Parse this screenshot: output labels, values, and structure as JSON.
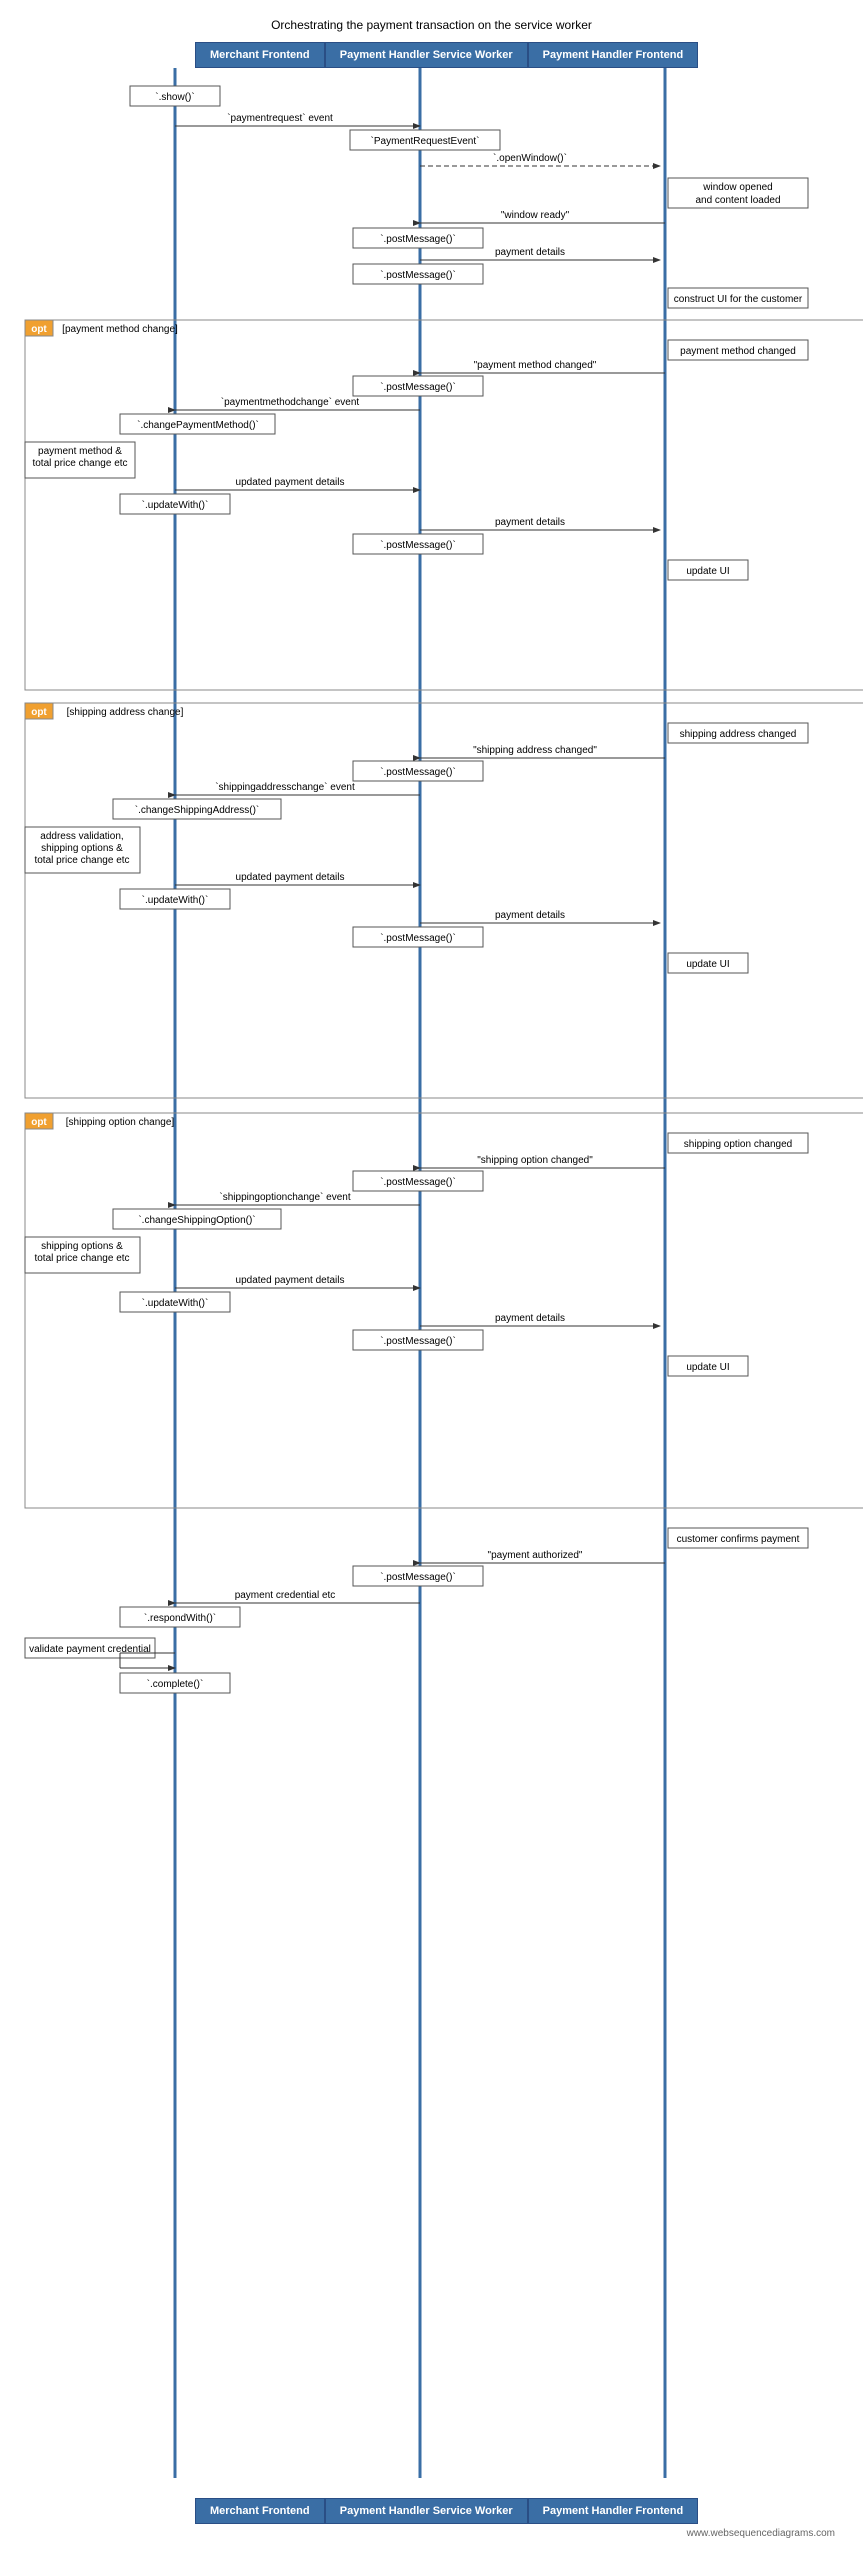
{
  "title": "Orchestrating the payment transaction on the service worker",
  "actors": {
    "merchant": "Merchant Frontend",
    "handler": "Payment Handler Service Worker",
    "frontend": "Payment Handler Frontend"
  },
  "footer_note": "www.websequencediagrams.com",
  "diagram": {
    "opt_sections": [
      {
        "label": "opt",
        "condition": "[payment method change]"
      },
      {
        "label": "opt",
        "condition": "[shipping address change]"
      },
      {
        "label": "opt",
        "condition": "[shipping option change]"
      }
    ],
    "messages": [
      "`.show()`",
      "`paymentrequest` event",
      "`PaymentRequestEvent`",
      "`.openWindow()`",
      "window opened and content loaded",
      "\"window ready\"",
      "`.postMessage()`",
      "payment details",
      "`.postMessage()`",
      "construct UI for the customer",
      "payment method changed",
      "\"payment method changed\"",
      "`.postMessage()`",
      "`paymentmethodchange` event",
      "`.changePaymentMethod()`",
      "payment method & total price change etc",
      "updated payment details",
      "`.updateWith()`",
      "payment details",
      "`.postMessage()`",
      "update UI"
    ]
  }
}
